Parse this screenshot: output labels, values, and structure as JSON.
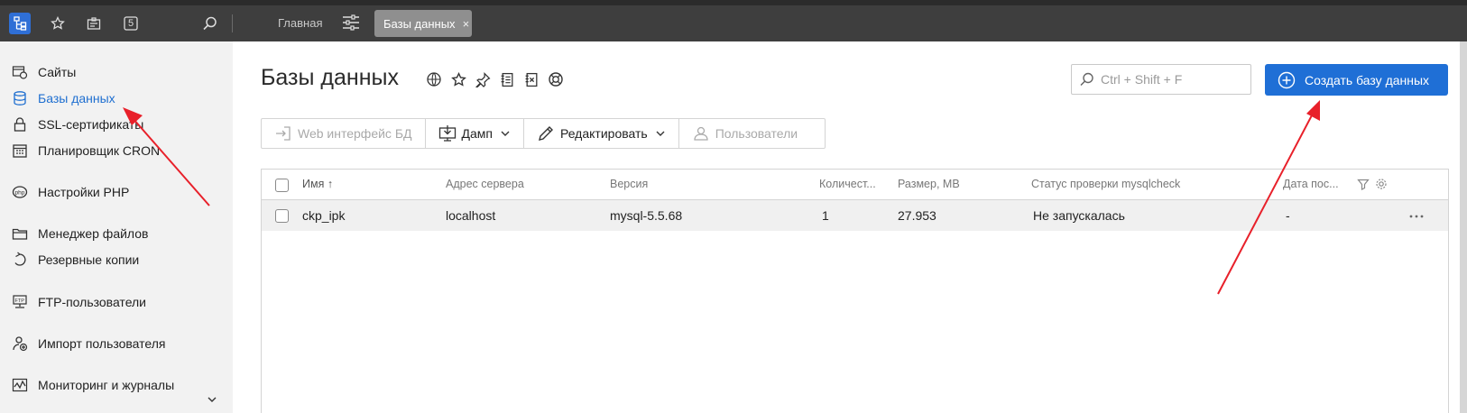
{
  "topbar": {
    "icons": [
      "sitemap-icon",
      "star-icon",
      "id-badge-icon",
      "number-five-icon",
      "search-icon",
      "sliders-icon"
    ],
    "five_label": "5",
    "tab_main": "Главная",
    "tab_active": "Базы данных",
    "tab_close": "×"
  },
  "sidebar": {
    "items": [
      {
        "label": "Сайты",
        "icon": "globe-window-icon"
      },
      {
        "label": "Базы данных",
        "icon": "database-icon",
        "active": true
      },
      {
        "label": "SSL-сертификаты",
        "icon": "lock-icon"
      },
      {
        "label": "Планировщик CRON",
        "icon": "calendar-icon"
      },
      {
        "label": "Настройки PHP",
        "icon": "php-icon"
      },
      {
        "label": "Менеджер файлов",
        "icon": "folder-icon"
      },
      {
        "label": "Резервные копии",
        "icon": "backup-icon"
      },
      {
        "label": "FTP-пользователи",
        "icon": "ftp-icon"
      },
      {
        "label": "Импорт пользователя",
        "icon": "user-import-icon"
      },
      {
        "label": "Мониторинг и журналы",
        "icon": "monitoring-icon"
      }
    ]
  },
  "page": {
    "title": "Базы данных",
    "title_icons": [
      "globe-icon",
      "star-icon",
      "pin-icon",
      "notes-icon",
      "close-doc-icon",
      "lifebuoy-icon"
    ],
    "search_placeholder": "Ctrl + Shift + F",
    "create_button": "Создать базу данных"
  },
  "toolbar": {
    "web_ui": "Web интерфейс БД",
    "dump": "Дамп",
    "edit": "Редактировать",
    "users": "Пользователи"
  },
  "table": {
    "columns": [
      "Имя ↑",
      "Адрес сервера",
      "Версия",
      "Количест...",
      "Размер, MB",
      "Статус проверки mysqlcheck",
      "Дата пос..."
    ],
    "rows": [
      {
        "name": "ckp_ipk",
        "server": "localhost",
        "version": "mysql-5.5.68",
        "count": "1",
        "size": "27.953",
        "status": "Не запускалась",
        "date": "-"
      }
    ]
  },
  "colors": {
    "accent": "#1f6fd6",
    "topbar": "#3e3e3e",
    "sidebar_bg": "#f2f2f2",
    "annotation_arrow": "#e8202a"
  }
}
